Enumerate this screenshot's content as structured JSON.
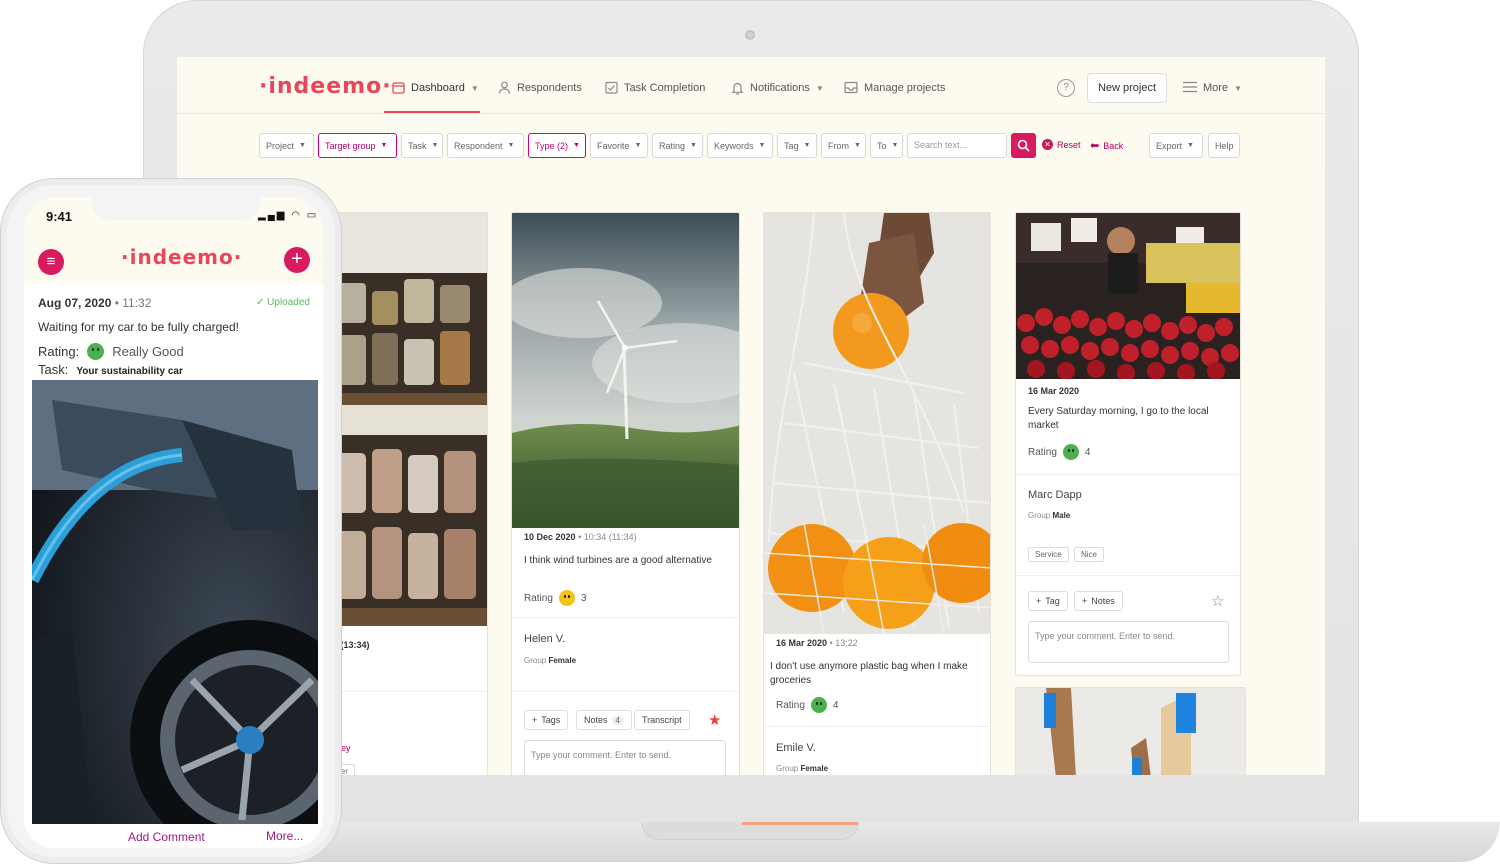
{
  "app": {
    "logo": "·indeemo·"
  },
  "nav": {
    "items": [
      {
        "label": "Dashboard",
        "icon": "calendar-icon"
      },
      {
        "label": "Respondents",
        "icon": "user-icon"
      },
      {
        "label": "Task Completion",
        "icon": "checkbox-icon"
      },
      {
        "label": "Notifications",
        "icon": "bell-icon"
      },
      {
        "label": "Manage projects",
        "icon": "inbox-icon"
      }
    ],
    "new_project": "New project",
    "more": "More"
  },
  "filters": {
    "project": "Project",
    "target_group": "Target group",
    "task": "Task",
    "respondent": "Respondent",
    "type": "Type (2)",
    "favorite": "Favorite",
    "rating": "Rating",
    "keywords": "Keywords",
    "tag": "Tag",
    "from": "From",
    "to": "To",
    "search_placeholder": "Search text...",
    "reset": "Reset",
    "back": "Back",
    "export": "Export",
    "help": "Help"
  },
  "cards": {
    "partial": {
      "time": "34 (13:34)",
      "journey": "urney",
      "user_tag": "User"
    },
    "wind": {
      "date": "10 Dec 2020",
      "time": "• 10:34 (11:34)",
      "text": "I think wind turbines are a good alternative",
      "rating_label": "Rating",
      "rating": "3",
      "name": "Helen V.",
      "group_label": "Group",
      "group": "Female",
      "tags": "Tags",
      "notes": "Notes",
      "notes_count": "4",
      "transcript": "Transcript",
      "comment_placeholder": "Type your comment. Enter to send."
    },
    "oranges": {
      "date": "16 Mar 2020",
      "time": "• 13:22",
      "text": "I don't use anymore plastic bag when I make groceries",
      "rating_label": "Rating",
      "rating": "4",
      "name": "Emile V.",
      "group_label": "Group",
      "group": "Female"
    },
    "market": {
      "date": "16 Mar 2020",
      "text": "Every Saturday morning, I go to the local market",
      "rating_label": "Rating",
      "rating": "4",
      "name": "Marc Dapp",
      "group_label": "Group",
      "group": "Male",
      "tag1": "Service",
      "tag2": "Nice",
      "tag_btn": "Tag",
      "notes_btn": "Notes",
      "comment_placeholder": "Type your comment. Enter to send."
    }
  },
  "phone": {
    "time": "9:41",
    "logo": "·indeemo·",
    "date": "Aug 07, 2020",
    "clock": "• 11:32",
    "uploaded": "Uploaded",
    "text": "Waiting for my car to be fully charged!",
    "rating_label": "Rating:",
    "rating_value": "Really Good",
    "task_label": "Task:",
    "task_value": "Your sustainability car",
    "add_comment": "Add Comment",
    "more": "More..."
  },
  "colors": {
    "brand": "#e8465a",
    "accent": "#d81b60",
    "link": "#9c1a7c",
    "background": "#fdfbf0"
  }
}
